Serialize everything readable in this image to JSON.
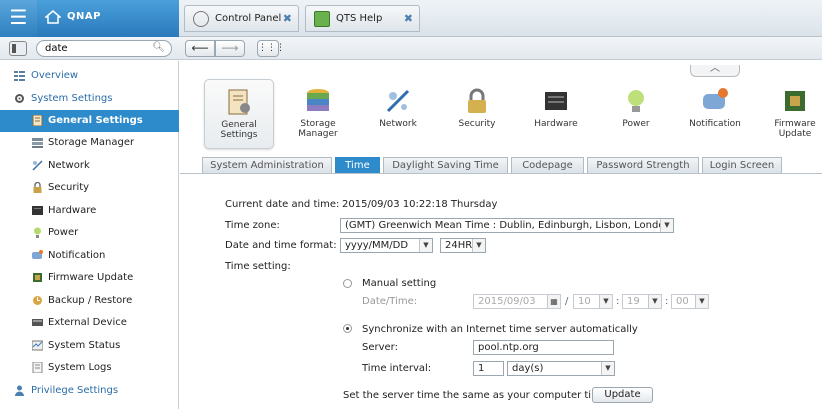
{
  "topbar": {
    "brand": "QNAP",
    "tabs": [
      {
        "label": "Control Panel",
        "close": "✖"
      },
      {
        "label": "QTS Help",
        "close": "✖"
      }
    ]
  },
  "toolbar": {
    "search_value": "date",
    "back": "⟵",
    "forward": "⟶",
    "apps": "⋮⋮⋮"
  },
  "sidebar": {
    "items": [
      {
        "label": "Overview",
        "icon": "overview-icon",
        "level": 1
      },
      {
        "label": "System Settings",
        "icon": "gear-icon",
        "level": 1
      },
      {
        "label": "General Settings",
        "icon": "general-settings-icon",
        "level": 2,
        "active": true
      },
      {
        "label": "Storage Manager",
        "icon": "storage-icon",
        "level": 2
      },
      {
        "label": "Network",
        "icon": "network-icon",
        "level": 2
      },
      {
        "label": "Security",
        "icon": "lock-icon",
        "level": 2
      },
      {
        "label": "Hardware",
        "icon": "hardware-icon",
        "level": 2
      },
      {
        "label": "Power",
        "icon": "bulb-icon",
        "level": 2
      },
      {
        "label": "Notification",
        "icon": "notification-icon",
        "level": 2
      },
      {
        "label": "Firmware Update",
        "icon": "firmware-icon",
        "level": 2
      },
      {
        "label": "Backup / Restore",
        "icon": "backup-icon",
        "level": 2
      },
      {
        "label": "External Device",
        "icon": "external-device-icon",
        "level": 2
      },
      {
        "label": "System Status",
        "icon": "status-icon",
        "level": 2
      },
      {
        "label": "System Logs",
        "icon": "logs-icon",
        "level": 2
      },
      {
        "label": "Privilege Settings",
        "icon": "user-icon",
        "level": 1
      }
    ]
  },
  "icons": [
    {
      "label1": "General",
      "label2": "Settings"
    },
    {
      "label1": "Storage",
      "label2": "Manager"
    },
    {
      "label1": "Network",
      "label2": ""
    },
    {
      "label1": "Security",
      "label2": ""
    },
    {
      "label1": "Hardware",
      "label2": ""
    },
    {
      "label1": "Power",
      "label2": ""
    },
    {
      "label1": "Notification",
      "label2": ""
    },
    {
      "label1": "Firmware",
      "label2": "Update"
    }
  ],
  "subtabs": [
    "System Administration",
    "Time",
    "Daylight Saving Time",
    "Codepage",
    "Password Strength",
    "Login Screen"
  ],
  "form": {
    "current_label": "Current date and time:",
    "current_value": "2015/09/03 10:22:18 Thursday",
    "timezone_label": "Time zone:",
    "timezone_value": "(GMT) Greenwich Mean Time : Dublin, Edinburgh, Lisbon, London",
    "format_label": "Date and time format:",
    "format_date": "yyyy/MM/DD",
    "format_hour": "24HR",
    "time_setting_label": "Time setting:",
    "manual_label": "Manual setting",
    "datetime_label": "Date/Time:",
    "manual_date": "2015/09/03",
    "manual_hour": "10",
    "manual_min": "19",
    "manual_sec": "00",
    "sep_slash": "/",
    "sep_colon": ":",
    "sync_label": "Synchronize with an Internet time server automatically",
    "server_label": "Server:",
    "server_value": "pool.ntp.org",
    "interval_label": "Time interval:",
    "interval_value": "1",
    "interval_unit": "day(s)",
    "same_time_label": "Set the server time the same as your computer time",
    "update_button": "Update"
  },
  "colors": {
    "accent": "#2d8bcb",
    "brand": "#3a8fd0"
  }
}
